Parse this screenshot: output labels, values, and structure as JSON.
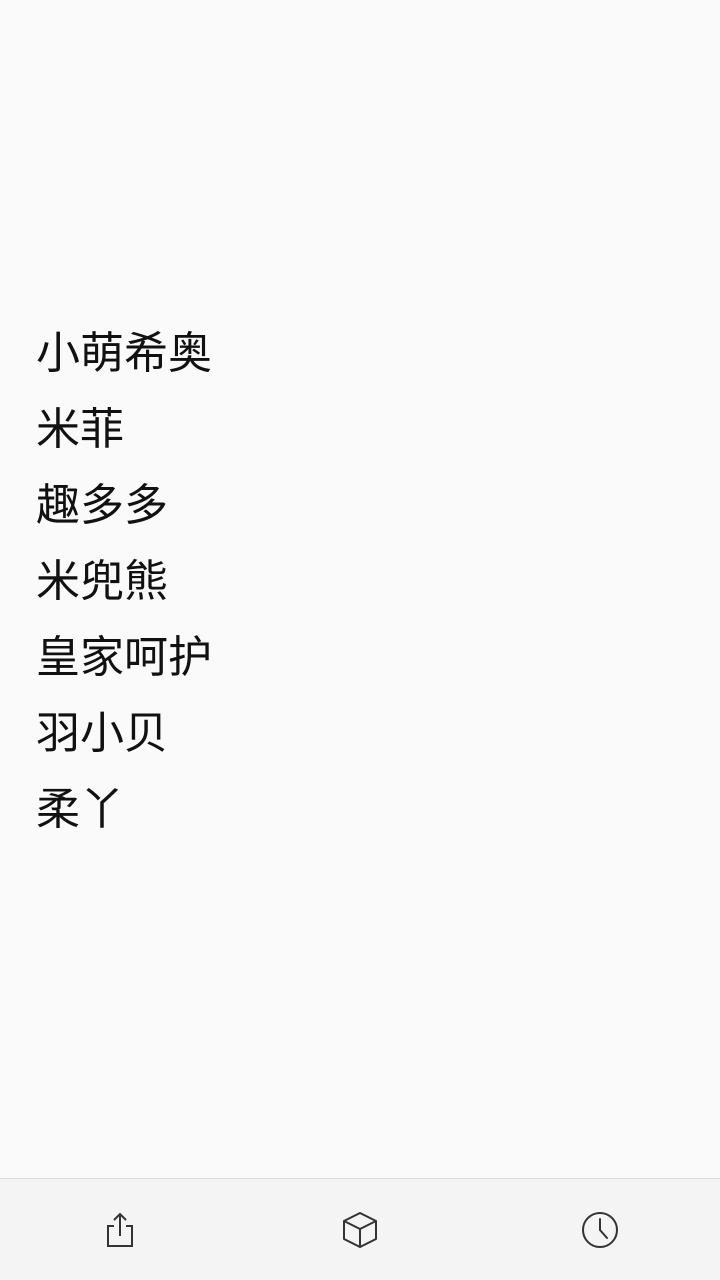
{
  "list": {
    "items": [
      {
        "label": "小萌希奥"
      },
      {
        "label": "米菲"
      },
      {
        "label": "趣多多"
      },
      {
        "label": "米兜熊"
      },
      {
        "label": "皇家呵护"
      },
      {
        "label": "羽小贝"
      },
      {
        "label": "柔丫"
      }
    ]
  },
  "toolbar": {
    "buttons": [
      {
        "icon": "share-icon"
      },
      {
        "icon": "cube-icon"
      },
      {
        "icon": "clock-icon"
      }
    ]
  },
  "colors": {
    "background": "#fafafa",
    "toolbar_background": "#f4f4f4",
    "text": "#111111",
    "icon": "#333333"
  }
}
